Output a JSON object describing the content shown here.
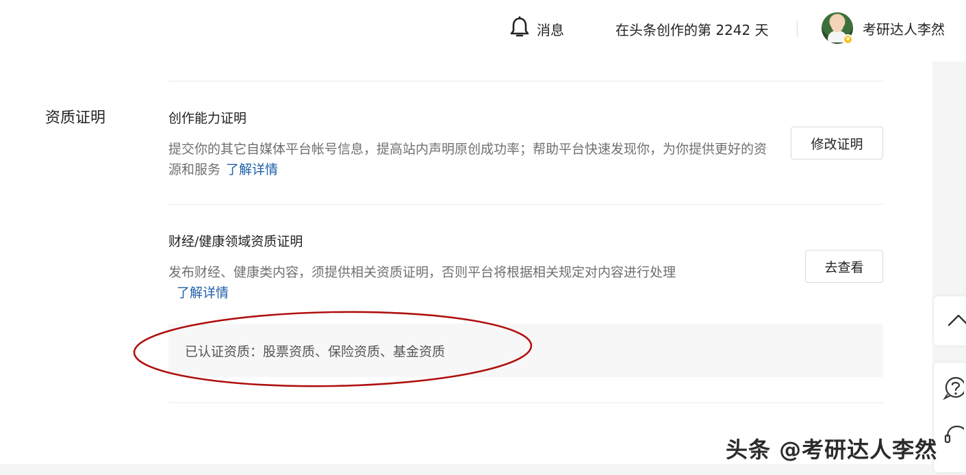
{
  "header": {
    "message_label": "消息",
    "creation_days": "在头条创作的第 2242 天",
    "username": "考研达人李然"
  },
  "section": {
    "title": "资质证明"
  },
  "items": [
    {
      "title": "创作能力证明",
      "description": "提交你的其它自媒体平台帐号信息，提高站内声明原创成功率；帮助平台快速发现你，为你提供更好的资源和服务",
      "link": "了解详情",
      "button": "修改证明"
    },
    {
      "title": "财经/健康领域资质证明",
      "description": "发布财经、健康类内容，须提供相关资质证明，否则平台将根据相关规定对内容进行处理",
      "link": "了解详情",
      "button": "去查看",
      "certified": "已认证资质：股票资质、保险资质、基金资质"
    }
  ],
  "annotation": {
    "color": "#b01010"
  },
  "watermark": "头条 @考研达人李然",
  "colors": {
    "link": "#1f5fa8",
    "text_secondary": "#707070"
  },
  "icons": {
    "bell": "bell-icon",
    "back_to_top": "chevron-up-icon",
    "help": "question-circle-icon",
    "support": "headset-icon"
  }
}
